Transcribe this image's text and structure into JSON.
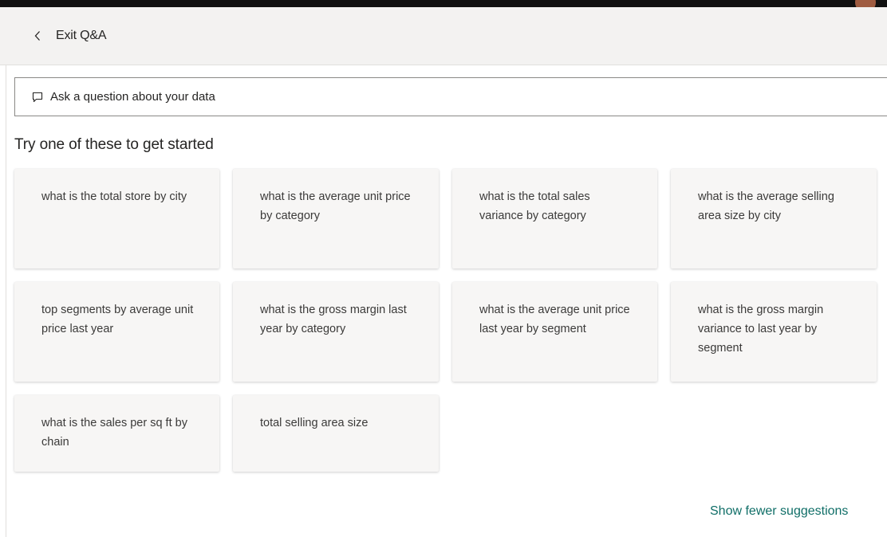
{
  "header": {
    "back_label": "Exit Q&A"
  },
  "ask": {
    "placeholder": "Ask a question about your data"
  },
  "suggestions": {
    "title": "Try one of these to get started",
    "items": [
      "what is the total store by city",
      "what is the average unit price by category",
      "what is the total sales variance by category",
      "what is the average selling area size by city",
      "top segments by average unit price last year",
      "what is the gross margin last year by category",
      "what is the average unit price last year by segment",
      "what is the gross margin variance to last year by segment",
      "what is the sales per sq ft by chain",
      "total selling area size"
    ],
    "toggle_label": "Show fewer suggestions"
  },
  "colors": {
    "header_bg": "#f3f2f1",
    "card_bg": "#f7f6f5",
    "link": "#0f6e67"
  }
}
